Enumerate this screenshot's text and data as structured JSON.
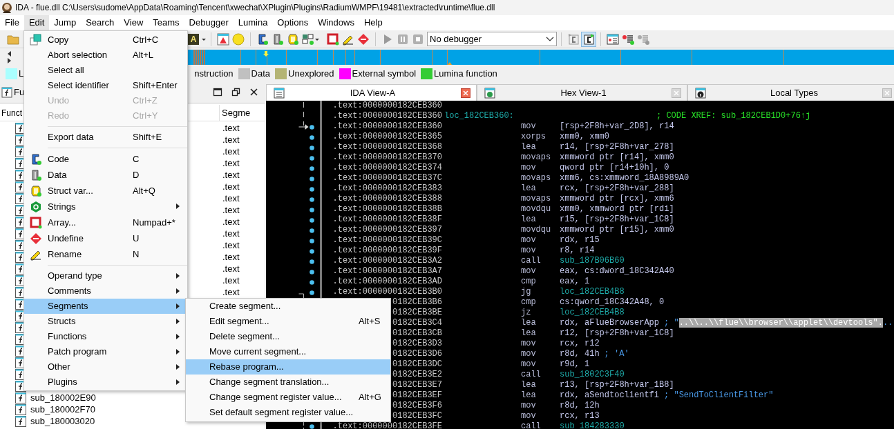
{
  "window": {
    "title": "IDA - flue.dll C:\\Users\\sudome\\AppData\\Roaming\\Tencent\\xwechat\\XPlugin\\Plugins\\RadiumWMPF\\19481\\extracted\\runtime\\flue.dll"
  },
  "menu_bar": [
    {
      "label": "File",
      "selected": false
    },
    {
      "label": "Edit",
      "selected": true
    },
    {
      "label": "Jump",
      "selected": false
    },
    {
      "label": "Search",
      "selected": false
    },
    {
      "label": "View",
      "selected": false
    },
    {
      "label": "Teams",
      "selected": false
    },
    {
      "label": "Debugger",
      "selected": false
    },
    {
      "label": "Lumina",
      "selected": false
    },
    {
      "label": "Options",
      "selected": false
    },
    {
      "label": "Windows",
      "selected": false
    },
    {
      "label": "Help",
      "selected": false
    }
  ],
  "toolbar": {
    "style_button": "A",
    "debugger": "No debugger"
  },
  "legend": [
    {
      "label": "L",
      "color": "#aaffff"
    },
    {
      "label": "nstruction"
    },
    {
      "label": "Data",
      "color": "#c0c0c0"
    },
    {
      "label": "Unexplored",
      "color": "#b4b474"
    },
    {
      "label": "External symbol",
      "color": "#ff00ff"
    },
    {
      "label": "Lumina function",
      "color": "#33cc33"
    }
  ],
  "functions_panel": {
    "title": "Fu",
    "columns": [
      "Funct",
      "Segme"
    ],
    "rows": [
      {
        "kind": "function",
        "segment": ".text"
      },
      {
        "kind": "function",
        "segment": ".text"
      },
      {
        "kind": "function",
        "segment": ".text"
      },
      {
        "kind": "function",
        "segment": ".text"
      },
      {
        "kind": "function",
        "segment": ".text"
      },
      {
        "kind": "function",
        "segment": ".text"
      },
      {
        "kind": "function",
        "segment": ".text"
      },
      {
        "kind": "function",
        "segment": ".text"
      },
      {
        "kind": "function",
        "segment": ".text"
      },
      {
        "kind": "function",
        "segment": ".text"
      },
      {
        "kind": "function",
        "segment": ".text"
      },
      {
        "kind": "function",
        "segment": ".text"
      },
      {
        "kind": "function",
        "segment": ".text"
      },
      {
        "kind": "function",
        "segment": ".text"
      },
      {
        "kind": "function",
        "segment": ".text"
      },
      {
        "kind": "function"
      },
      {
        "kind": "function"
      },
      {
        "kind": "function"
      },
      {
        "kind": "function"
      },
      {
        "kind": "function"
      },
      {
        "kind": "function"
      },
      {
        "kind": "function"
      },
      {
        "kind": "function"
      },
      {
        "kind": "function",
        "name": "sub_180002E90"
      },
      {
        "kind": "function",
        "name": "sub_180002F70"
      },
      {
        "kind": "function",
        "name": "sub_180003020"
      }
    ]
  },
  "tabs": [
    {
      "label": "IDA View-A",
      "selected": true
    },
    {
      "label": "Hex View-1",
      "selected": false
    },
    {
      "label": "Local Types",
      "selected": false
    }
  ],
  "disassembly": {
    "lines": [
      {
        "address": ".text:0000000182CEB360"
      },
      {
        "address": ".text:0000000182CEB360",
        "label": "loc_182CEB360:",
        "comment": {
          "kind": "xref",
          "parts": [
            {
              "text": "; CODE XREF: sub_182CEB1D0+76↑j",
              "highlighted": false
            }
          ]
        }
      },
      {
        "address": ".text:0000000182CEB360",
        "mnemonic": "mov",
        "operands": {
          "kind": "plain",
          "text": "[rsp+2F8h+var_2D8], r14"
        }
      },
      {
        "address": ".text:0000000182CEB365",
        "mnemonic": "xorps",
        "operands": {
          "kind": "plain",
          "text": "xmm0, xmm0"
        }
      },
      {
        "address": ".text:0000000182CEB368",
        "mnemonic": "lea",
        "operands": {
          "kind": "plain",
          "text": "r14, [rsp+2F8h+var_278]"
        }
      },
      {
        "address": ".text:0000000182CEB370",
        "mnemonic": "movaps",
        "operands": {
          "kind": "plain",
          "text": "xmmword ptr [r14], xmm0"
        }
      },
      {
        "address": ".text:0000000182CEB374",
        "mnemonic": "mov",
        "operands": {
          "kind": "plain",
          "text": "qword ptr [r14+10h], 0"
        }
      },
      {
        "address": ".text:0000000182CEB37C",
        "mnemonic": "movaps",
        "operands": {
          "kind": "plain",
          "text": "xmm6, cs:xmmword_18A8989A0"
        }
      },
      {
        "address": ".text:0000000182CEB383",
        "mnemonic": "lea",
        "operands": {
          "kind": "plain",
          "text": "rcx, [rsp+2F8h+var_288]"
        }
      },
      {
        "address": ".text:0000000182CEB388",
        "mnemonic": "movaps",
        "operands": {
          "kind": "plain",
          "text": "xmmword ptr [rcx], xmm6"
        }
      },
      {
        "address": ".text:0000000182CEB38B",
        "mnemonic": "movdqu",
        "operands": {
          "kind": "plain",
          "text": "xmm0, xmmword ptr [rdi]"
        }
      },
      {
        "address": ".text:0000000182CEB38F",
        "mnemonic": "lea",
        "operands": {
          "kind": "plain",
          "text": "r15, [rsp+2F8h+var_1C8]"
        }
      },
      {
        "address": ".text:0000000182CEB397",
        "mnemonic": "movdqu",
        "operands": {
          "kind": "plain",
          "text": "xmmword ptr [r15], xmm0"
        }
      },
      {
        "address": ".text:0000000182CEB39C",
        "mnemonic": "mov",
        "operands": {
          "kind": "plain",
          "text": "rdx, r15"
        }
      },
      {
        "address": ".text:0000000182CEB39F",
        "mnemonic": "mov",
        "operands": {
          "kind": "plain",
          "text": "r8, r14"
        }
      },
      {
        "address": ".text:0000000182CEB3A2",
        "mnemonic": "call",
        "operands": {
          "kind": "ref",
          "text": "sub_187B06B60"
        }
      },
      {
        "address": ".text:0000000182CEB3A7",
        "mnemonic": "mov",
        "operands": {
          "kind": "plain",
          "text": "eax, cs:dword_18C342A40"
        }
      },
      {
        "address": ".text:0000000182CEB3AD",
        "mnemonic": "cmp",
        "operands": {
          "kind": "plain",
          "text": "eax, 1"
        }
      },
      {
        "address": ".text:0000000182CEB3B0",
        "mnemonic": "jg",
        "operands": {
          "kind": "ref",
          "text": "loc_182CEB4B8"
        }
      },
      {
        "address": "0182CEB3B6",
        "mnemonic": "cmp",
        "operands": {
          "kind": "plain",
          "text": "cs:qword_18C342A48, 0"
        }
      },
      {
        "address": "0182CEB3BE",
        "mnemonic": "jz",
        "operands": {
          "kind": "ref",
          "text": "loc_182CEB4B8"
        }
      },
      {
        "address": "0182CEB3C4",
        "mnemonic": "lea",
        "operands": {
          "kind": "plain",
          "text": "rdx, aFlueBrowserApp"
        },
        "comment": {
          "kind": "string",
          "parts": [
            {
              "text": "; \"",
              "highlighted": false
            },
            {
              "text": "..\\\\..\\\\flue\\\\browser\\\\applet\\\\devtools\".",
              "highlighted": true
            },
            {
              "text": "..",
              "highlighted": false
            }
          ]
        }
      },
      {
        "address": "0182CEB3CB",
        "mnemonic": "lea",
        "operands": {
          "kind": "plain",
          "text": "r12, [rsp+2F8h+var_1C8]"
        }
      },
      {
        "address": "0182CEB3D3",
        "mnemonic": "mov",
        "operands": {
          "kind": "plain",
          "text": "rcx, r12"
        }
      },
      {
        "address": "0182CEB3D6",
        "mnemonic": "mov",
        "operands": {
          "kind": "plain",
          "text": "r8d, 41h"
        },
        "comment": {
          "kind": "string",
          "parts": [
            {
              "text": "; 'A'",
              "highlighted": false
            }
          ]
        }
      },
      {
        "address": "0182CEB3DC",
        "mnemonic": "mov",
        "operands": {
          "kind": "plain",
          "text": "r9d, 1"
        }
      },
      {
        "address": "0182CEB3E2",
        "mnemonic": "call",
        "operands": {
          "kind": "ref",
          "text": "sub_1802C3F40"
        }
      },
      {
        "address": "0182CEB3E7",
        "mnemonic": "lea",
        "operands": {
          "kind": "plain",
          "text": "r13, [rsp+2F8h+var_1B8]"
        }
      },
      {
        "address": "0182CEB3EF",
        "mnemonic": "lea",
        "operands": {
          "kind": "plain",
          "text": "rdx, aSendtoclientfi"
        },
        "comment": {
          "kind": "string",
          "parts": [
            {
              "text": "; \"SendToClientFilter\"",
              "highlighted": false
            }
          ]
        }
      },
      {
        "address": "0182CEB3F6",
        "mnemonic": "mov",
        "operands": {
          "kind": "plain",
          "text": "r8d, 12h"
        }
      },
      {
        "address": "0182CEB3FC",
        "mnemonic": "mov",
        "operands": {
          "kind": "plain",
          "text": "rcx, r13"
        }
      },
      {
        "address": ".text:0000000182CEB3FE",
        "mnemonic": "call",
        "operands": {
          "kind": "ref",
          "text": "sub_184283330"
        }
      }
    ]
  },
  "edit_menu": {
    "items": [
      {
        "kind": "item",
        "label": "Copy",
        "shortcut": "Ctrl+C",
        "disabled": false,
        "selected": false,
        "submenu": false
      },
      {
        "kind": "item",
        "label": "Abort selection",
        "shortcut": "Alt+L",
        "disabled": false,
        "selected": false,
        "submenu": false
      },
      {
        "kind": "item",
        "label": "Select all",
        "disabled": false,
        "selected": false,
        "submenu": false
      },
      {
        "kind": "item",
        "label": "Select identifier",
        "shortcut": "Shift+Enter",
        "disabled": false,
        "selected": false,
        "submenu": false
      },
      {
        "kind": "item",
        "label": "Undo",
        "shortcut": "Ctrl+Z",
        "disabled": true,
        "selected": false,
        "submenu": false
      },
      {
        "kind": "item",
        "label": "Redo",
        "shortcut": "Ctrl+Y",
        "disabled": true,
        "selected": false,
        "submenu": false
      },
      {
        "kind": "separator"
      },
      {
        "kind": "item",
        "label": "Export data",
        "shortcut": "Shift+E",
        "disabled": false,
        "selected": false,
        "submenu": false
      },
      {
        "kind": "separator"
      },
      {
        "kind": "item",
        "label": "Code",
        "shortcut": "C",
        "disabled": false,
        "selected": false,
        "submenu": false
      },
      {
        "kind": "item",
        "label": "Data",
        "shortcut": "D",
        "disabled": false,
        "selected": false,
        "submenu": false
      },
      {
        "kind": "item",
        "label": "Struct var...",
        "shortcut": "Alt+Q",
        "disabled": false,
        "selected": false,
        "submenu": false
      },
      {
        "kind": "item",
        "label": "Strings",
        "disabled": false,
        "selected": false,
        "submenu": true
      },
      {
        "kind": "item",
        "label": "Array...",
        "shortcut": "Numpad+*",
        "disabled": false,
        "selected": false,
        "submenu": false
      },
      {
        "kind": "item",
        "label": "Undefine",
        "shortcut": "U",
        "disabled": false,
        "selected": false,
        "submenu": false
      },
      {
        "kind": "item",
        "label": "Rename",
        "shortcut": "N",
        "disabled": false,
        "selected": false,
        "submenu": false
      },
      {
        "kind": "separator"
      },
      {
        "kind": "item",
        "label": "Operand type",
        "disabled": false,
        "selected": false,
        "submenu": true
      },
      {
        "kind": "item",
        "label": "Comments",
        "disabled": false,
        "selected": false,
        "submenu": true
      },
      {
        "kind": "item",
        "label": "Segments",
        "disabled": false,
        "selected": true,
        "submenu": true
      },
      {
        "kind": "item",
        "label": "Structs",
        "disabled": false,
        "selected": false,
        "submenu": true
      },
      {
        "kind": "item",
        "label": "Functions",
        "disabled": false,
        "selected": false,
        "submenu": true
      },
      {
        "kind": "item",
        "label": "Patch program",
        "disabled": false,
        "selected": false,
        "submenu": true
      },
      {
        "kind": "item",
        "label": "Other",
        "disabled": false,
        "selected": false,
        "submenu": true
      },
      {
        "kind": "item",
        "label": "Plugins",
        "disabled": false,
        "selected": false,
        "submenu": true
      }
    ]
  },
  "segments_submenu": {
    "items": [
      {
        "kind": "item",
        "label": "Create segment...",
        "disabled": false,
        "selected": false,
        "submenu": false
      },
      {
        "kind": "item",
        "label": "Edit segment...",
        "shortcut": "Alt+S",
        "disabled": false,
        "selected": false,
        "submenu": false
      },
      {
        "kind": "item",
        "label": "Delete segment...",
        "disabled": false,
        "selected": false,
        "submenu": false
      },
      {
        "kind": "item",
        "label": "Move current segment...",
        "disabled": false,
        "selected": false,
        "submenu": false
      },
      {
        "kind": "item",
        "label": "Rebase program...",
        "disabled": false,
        "selected": true,
        "submenu": false
      },
      {
        "kind": "item",
        "label": "Change segment translation...",
        "disabled": false,
        "selected": false,
        "submenu": false
      },
      {
        "kind": "item",
        "label": "Change segment register value...",
        "shortcut": "Alt+G",
        "disabled": false,
        "selected": false,
        "submenu": false
      },
      {
        "kind": "item",
        "label": "Set default segment register value...",
        "disabled": false,
        "selected": false,
        "submenu": false
      }
    ]
  }
}
